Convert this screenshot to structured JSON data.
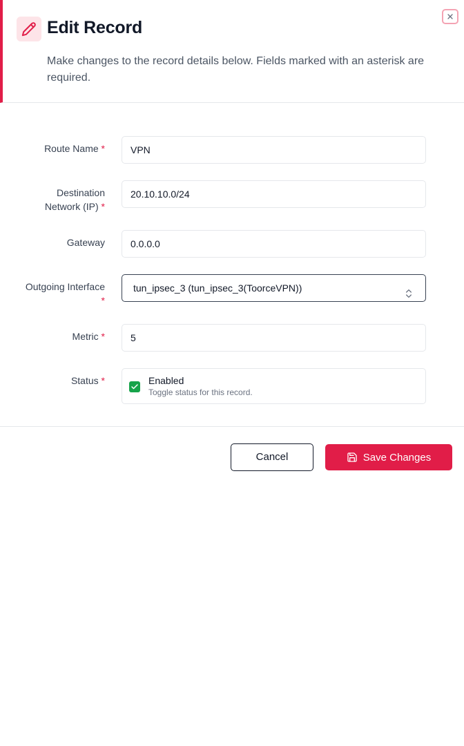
{
  "dialog": {
    "title": "Edit Record",
    "description": "Make changes to the record details below. Fields marked with an asterisk are required.",
    "accent_color": "#e11d48"
  },
  "icons": {
    "header": "pencil-icon",
    "close": "close-icon",
    "select": "chevron-up-down-icon",
    "checkbox": "check-icon",
    "save": "save-icon"
  },
  "fields": {
    "route_name": {
      "label": "Route Name",
      "required": "*",
      "value": "VPN"
    },
    "destination": {
      "label_line1": "Destination",
      "label_line2": "Network (IP)",
      "required": "*",
      "value": "20.10.10.0/24"
    },
    "gateway": {
      "label": "Gateway",
      "value": "0.0.0.0"
    },
    "interface": {
      "label": "Outgoing Interface",
      "required": "*",
      "value": "tun_ipsec_3 (tun_ipsec_3(ToorceVPN))"
    },
    "metric": {
      "label": "Metric",
      "required": "*",
      "value": "5"
    },
    "status": {
      "label": "Status",
      "required": "*",
      "checkbox_label": "Enabled",
      "checkbox_help": "Toggle status for this record.",
      "checked": true,
      "check_color": "#16a34a"
    }
  },
  "footer": {
    "cancel_label": "Cancel",
    "save_label": "Save Changes"
  }
}
